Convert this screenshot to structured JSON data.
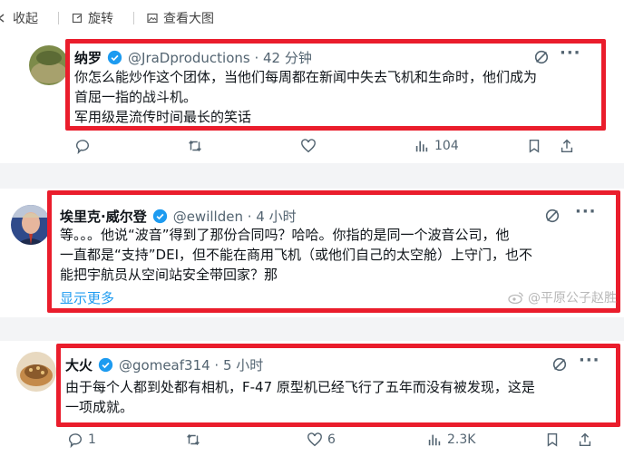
{
  "toolbar": {
    "collapse": "收起",
    "rotate": "旋转",
    "view_large": "查看大图"
  },
  "tweets": [
    {
      "name": "纳罗",
      "handle": "@JraDproductions · 42 分钟",
      "lines": [
        "你怎么能炒作这个团体，当他们每周都在新闻中失去飞机和生命时，他们成为",
        "首屈一指的战斗机。",
        "军用级是流传时间最长的笑话"
      ],
      "views": "104"
    },
    {
      "name": "埃里克·威尔登",
      "handle": "@ewillden · 4 小时",
      "lines": [
        "等。。。他说“波音”得到了那份合同吗？哈哈。你指的是同一个波音公司，他",
        "一直都是“支持”DEI，但不能在商用飞机（或他们自己的太空舱）上守门，也不",
        "能把宇航员从空间站安全带回家？那"
      ],
      "show_more": "显示更多"
    },
    {
      "name": "大火",
      "handle": "@gomeaf314 · 5 小时",
      "lines": [
        "由于每个人都到处都有相机，F-47 原型机已经飞行了五年而没有被发现，这是",
        "一项成就。"
      ],
      "replies": "1",
      "likes": "6",
      "views": "2.3K"
    }
  ],
  "watermark": "@平原公子赵胜",
  "colors": {
    "highlight": "#ea1d2c",
    "verified": "#1d9bf0",
    "link": "#1d9bf0",
    "muted": "#536471"
  }
}
